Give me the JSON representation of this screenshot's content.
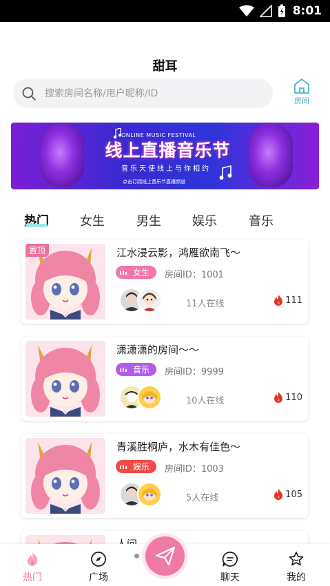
{
  "status_bar": {
    "time": "8:01"
  },
  "app": {
    "title": "甜耳"
  },
  "search": {
    "placeholder": "搜索房间名称/用户昵称/ID"
  },
  "rooms_button": {
    "label": "房间"
  },
  "banner": {
    "subtitle_en": "ONLINE MUSIC FESTIVAL",
    "title": "线上直播音乐节",
    "slogan": "音乐天使线上与你相约",
    "small_text": "点击订阅线上音乐节直播频道"
  },
  "tabs": [
    "热门",
    "女生",
    "男生",
    "娱乐",
    "音乐"
  ],
  "active_tab": 0,
  "rooms": [
    {
      "pinned": true,
      "pin_label": "置顶",
      "title": "江水浸云影，鸿雁欲南飞～",
      "tag": "女生",
      "tag_color": "#ef77aa",
      "room_id": "房间ID：1001",
      "online": "11人在线",
      "heat": "111"
    },
    {
      "pinned": false,
      "title": "潇潇潇的房间～～",
      "tag": "音乐",
      "tag_color": "#b05ee8",
      "room_id": "房间ID：9999",
      "online": "10人在线",
      "heat": "110"
    },
    {
      "pinned": false,
      "title": "青溪胜桐庐，水木有佳色～",
      "tag": "娱乐",
      "tag_color": "#f24b47",
      "room_id": "房间ID：1003",
      "online": "5人在线",
      "heat": "105"
    },
    {
      "pinned": false,
      "title": "人间…",
      "tag": "",
      "tag_color": "#ef77aa",
      "room_id": "",
      "online": "",
      "heat": ""
    }
  ],
  "colors": {
    "accent_pink": "#ec6fa0",
    "heat_red": "#e8321e",
    "rooms_icon": "#45b3cf"
  },
  "tabbar": {
    "items": [
      {
        "label": "热门",
        "icon": "hot-icon",
        "active": true
      },
      {
        "label": "广场",
        "icon": "compass-icon",
        "active": false
      },
      {
        "label": "聊天",
        "icon": "chat-icon",
        "active": false
      },
      {
        "label": "我的",
        "icon": "star-face-icon",
        "active": false
      }
    ],
    "fab_icon": "paper-plane-icon"
  }
}
